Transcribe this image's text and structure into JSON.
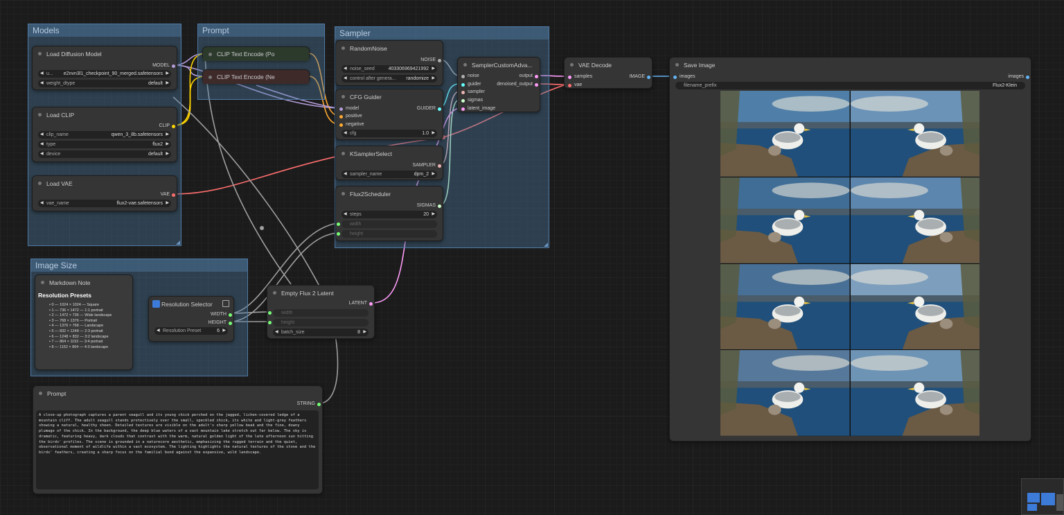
{
  "groups": {
    "models": "Models",
    "prompt": "Prompt",
    "sampler": "Sampler",
    "image_size": "Image Size"
  },
  "load_diffusion_model": {
    "title": "Load Diffusion Model",
    "output": "MODEL",
    "unet_label": "u...",
    "unet_value": "e2nvn3l1_checkpoint_90_merged.safetensors",
    "weight_dtype_label": "weight_dtype",
    "weight_dtype_value": "default"
  },
  "load_clip": {
    "title": "Load CLIP",
    "output": "CLIP",
    "clip_name_label": "clip_name",
    "clip_name_value": "qwen_3_8b.safetensors",
    "type_label": "type",
    "type_value": "flux2",
    "device_label": "device",
    "device_value": "default"
  },
  "load_vae": {
    "title": "Load VAE",
    "output": "VAE",
    "vae_name_label": "vae_name",
    "vae_name_value": "flux2-vae.safetensors"
  },
  "clip_pos": {
    "title": "CLIP Text Encode (Po"
  },
  "clip_neg": {
    "title": "CLIP Text Encode (Ne"
  },
  "random_noise": {
    "title": "RandomNoise",
    "output": "NOISE",
    "seed_label": "noise_seed",
    "seed_value": "403306969421992",
    "control_label": "control after genera...",
    "control_value": "randomize"
  },
  "cfg_guider": {
    "title": "CFG Guider",
    "output": "GUIDER",
    "in_model": "model",
    "in_positive": "positive",
    "in_negative": "negative",
    "cfg_label": "cfg",
    "cfg_value": "1.0"
  },
  "ksampler_select": {
    "title": "KSamplerSelect",
    "output": "SAMPLER",
    "sampler_label": "sampler_name",
    "sampler_value": "dpm_2"
  },
  "flux2_scheduler": {
    "title": "Flux2Scheduler",
    "output": "SIGMAS",
    "steps_label": "steps",
    "steps_value": "20",
    "width_label": "width",
    "height_label": "height"
  },
  "sampler_custom": {
    "title": "SamplerCustomAdva...",
    "in_noise": "noise",
    "in_guider": "guider",
    "in_sampler": "sampler",
    "in_sigmas": "sigmas",
    "in_latent": "latent_image",
    "out_output": "output",
    "out_denoised": "denoised_output"
  },
  "vae_decode": {
    "title": "VAE Decode",
    "in_samples": "samples",
    "in_vae": "vae",
    "output": "IMAGE"
  },
  "save_image": {
    "title": "Save Image",
    "in_images": "images",
    "out_images": "images",
    "prefix_label": "filename_prefix",
    "prefix_value": "Flux2-Klein"
  },
  "markdown_note": {
    "title": "Markdown Note",
    "heading": "Resolution Presets",
    "items": [
      "0 — 1024 × 1024 — Square",
      "1 — 736 × 1472 — 1:1 portrait",
      "2 — 1472 × 736 — Wide landscape",
      "3 — 768 × 1376 — Portrait",
      "4 — 1376 × 768 — Landscape",
      "5 — 832 × 1248 — 2:3 portrait",
      "6 — 1248 × 832 — 3:2 landscape",
      "7 — 864 × 1152 — 3:4 portrait",
      "8 — 1152 × 864 — 4:3 landscape"
    ]
  },
  "resolution_selector": {
    "title": "Resolution Selector",
    "out_width": "WIDTH",
    "out_height": "HEIGHT",
    "preset_label": "Resolution Preset",
    "preset_value": "6"
  },
  "empty_latent": {
    "title": "Empty Flux 2 Latent",
    "output": "LATENT",
    "width_label": "width",
    "height_label": "height",
    "batch_label": "batch_size",
    "batch_value": "8"
  },
  "prompt_node": {
    "title": "Prompt",
    "output": "STRING",
    "text": "A close-up photograph captures a parent seagull and its young chick perched on the jagged, lichen-covered ledge of a mountain cliff. The adult seagull stands protectively over the small, speckled chick, its white and light-grey feathers showing a natural, healthy sheen. Detailed textures are visible on the adult's sharp yellow beak and the fine, downy plumage of the chick. In the background, the deep blue waters of a vast mountain lake stretch out far below. The sky is dramatic, featuring heavy, dark clouds that contrast with the warm, natural golden light of the late afternoon sun hitting the birds' profiles. The scene is grounded in a naturecore aesthetic, emphasizing the rugged terrain and the quiet, observational moment of wildlife within a vast ecosystem. The lighting highlights the natural textures of the stone and the birds' feathers, creating a sharp focus on the familial bond against the expansive, wild landscape."
  },
  "colors": {
    "model": "#b39ddb",
    "clip": "#ffd500",
    "vae": "#ff6e6e",
    "conditioning": "#ffa931",
    "latent": "#ff9cf9",
    "noise": "#b0b0b0",
    "guider": "#66ffff",
    "sampler": "#ecb4b4",
    "sigmas": "#cdffcd",
    "image": "#64b5f6",
    "int": "#29699c",
    "string": "#77ff77"
  }
}
